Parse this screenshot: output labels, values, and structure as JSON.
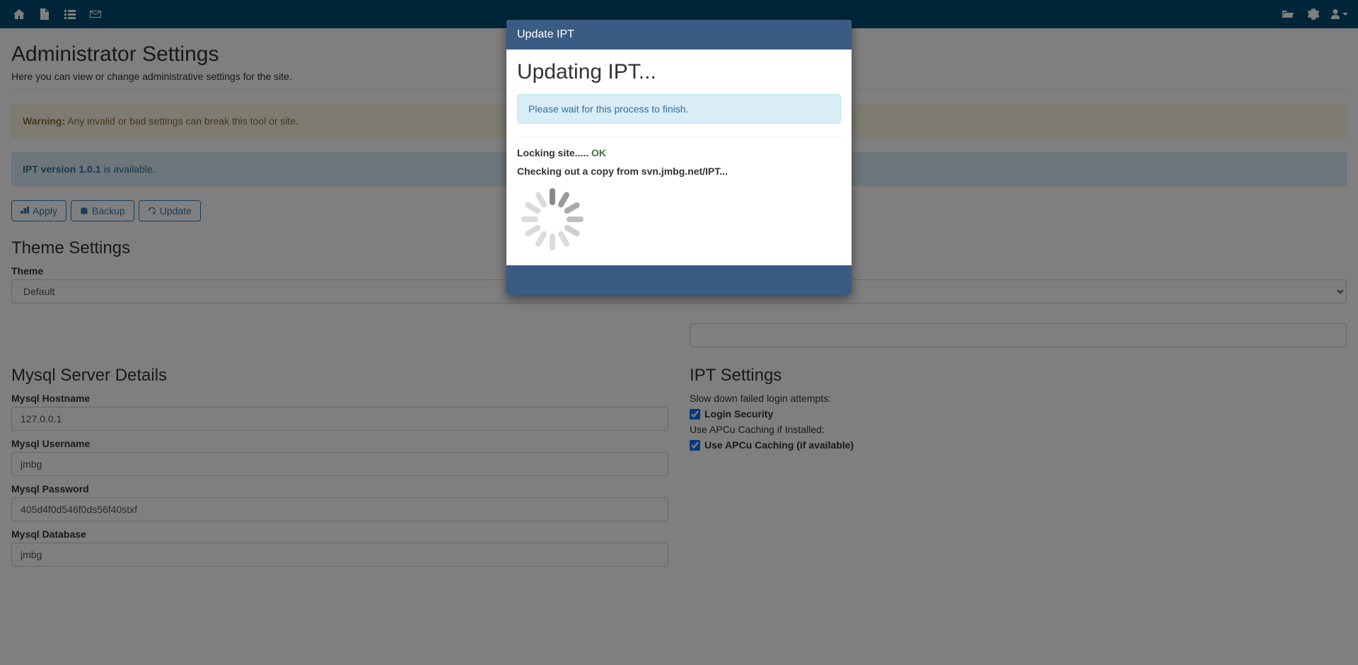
{
  "navbar": {
    "icons_left": [
      "home",
      "file",
      "list",
      "envelope"
    ],
    "icons_right": [
      "folder-open",
      "gear",
      "user"
    ]
  },
  "page": {
    "title": "Administrator Settings",
    "subtitle": "Here you can view or change administrative settings for the site.",
    "warning_label": "Warning:",
    "warning_text": " Any invalid or bad settings can break this tool or site.",
    "version_msg_strong": "IPT version 1.0.1",
    "version_msg_rest": " is available."
  },
  "buttons": {
    "apply": "Apply",
    "backup": "Backup",
    "update": "Update"
  },
  "theme": {
    "heading": "Theme Settings",
    "label": "Theme",
    "value": "Default"
  },
  "mysql": {
    "heading": "Mysql Server Details",
    "hostname_label": "Mysql Hostname",
    "hostname_value": "127.0.0.1",
    "username_label": "Mysql Username",
    "username_value": "jmbg",
    "password_label": "Mysql Password",
    "password_value": "405d4f0d546f0ds56f40stxf",
    "database_label": "Mysql Database",
    "database_value": "jmbg"
  },
  "ipt": {
    "heading": "IPT Settings",
    "login_help": "Slow down failed login attempts:",
    "login_label": "Login Security",
    "apcu_help": "Use APCu Caching if Installed:",
    "apcu_label": "Use APCu Caching (if available)"
  },
  "modal": {
    "title": "Update IPT",
    "heading": "Updating IPT...",
    "wait_msg": "Please wait for this process to finish.",
    "log1_prefix": "Locking site..... ",
    "log1_ok": "OK",
    "log2": "Checking out a copy from svn.jmbg.net/IPT..."
  }
}
